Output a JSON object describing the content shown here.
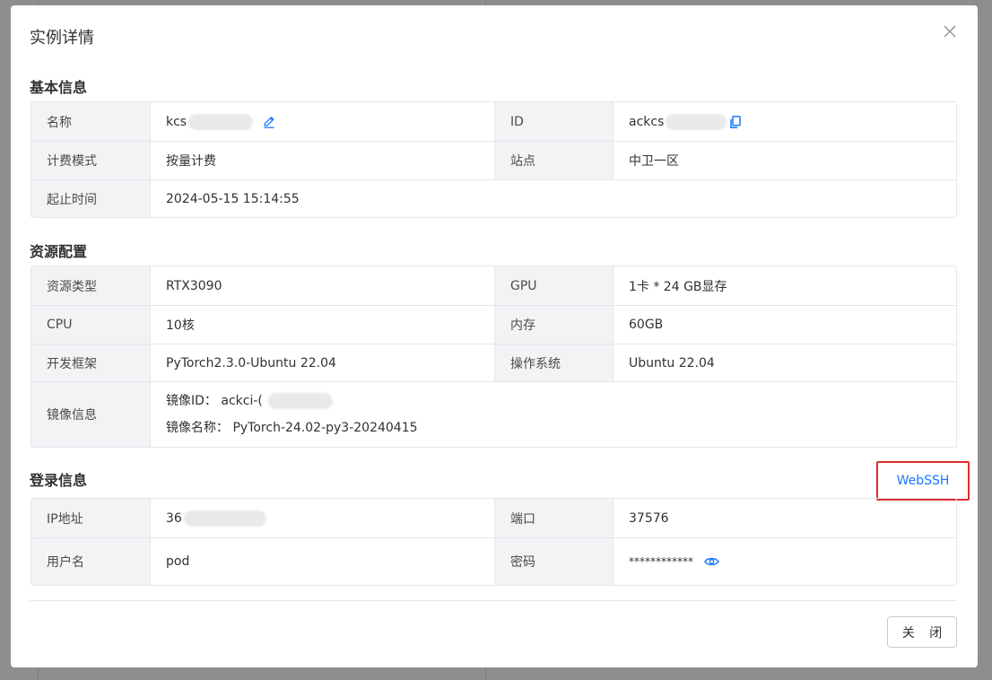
{
  "modal": {
    "title": "实例详情",
    "close_button": "关 闭"
  },
  "basic": {
    "title": "基本信息",
    "name_label": "名称",
    "name_value": "kcs",
    "id_label": "ID",
    "id_value": "ackcs",
    "billing_label": "计费模式",
    "billing_value": "按量计费",
    "site_label": "站点",
    "site_value": "中卫一区",
    "time_label": "起止时间",
    "time_value": "2024-05-15 15:14:55"
  },
  "resource": {
    "title": "资源配置",
    "type_label": "资源类型",
    "type_value": "RTX3090",
    "gpu_label": "GPU",
    "gpu_value": "1卡 * 24 GB显存",
    "cpu_label": "CPU",
    "cpu_value": "10核",
    "memory_label": "内存",
    "memory_value": "60GB",
    "framework_label": "开发框架",
    "framework_value": "PyTorch2.3.0-Ubuntu 22.04",
    "os_label": "操作系统",
    "os_value": "Ubuntu 22.04",
    "image_label": "镜像信息",
    "image_id_label": "镜像ID：",
    "image_id_value": "ackci-(",
    "image_name_label": "镜像名称：",
    "image_name_value": "PyTorch-24.02-py3-20240415"
  },
  "login": {
    "title": "登录信息",
    "webssh": "WebSSH",
    "ip_label": "IP地址",
    "ip_value": "36",
    "port_label": "端口",
    "port_value": "37576",
    "user_label": "用户名",
    "user_value": "pod",
    "password_label": "密码",
    "password_value": "************"
  },
  "colors": {
    "accent": "#1677ff",
    "highlight": "#e02c2c",
    "label_bg": "#f2f3f5"
  }
}
